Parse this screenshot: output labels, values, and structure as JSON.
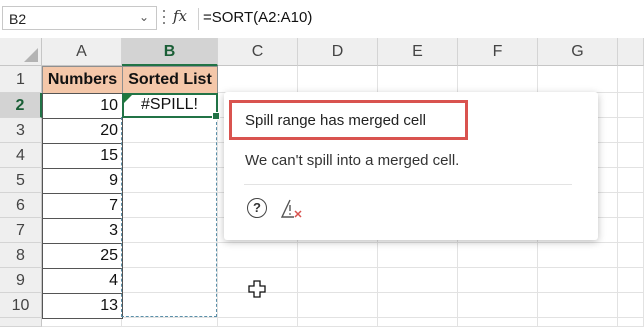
{
  "formula_bar": {
    "name_box": "B2",
    "name_box_dropdown_icon": "chevron-down-icon",
    "fx_label": "fx",
    "formula": "=SORT(A2:A10)"
  },
  "columns": [
    "A",
    "B",
    "C",
    "D",
    "E",
    "F",
    "G"
  ],
  "rows": [
    "1",
    "2",
    "3",
    "4",
    "5",
    "6",
    "7",
    "8",
    "9",
    "10"
  ],
  "sheet": {
    "a1": "Numbers",
    "b1": "Sorted List",
    "numbers": [
      "10",
      "20",
      "15",
      "9",
      "7",
      "3",
      "25",
      "4",
      "13"
    ],
    "b2": "#SPILL!"
  },
  "popup": {
    "title": "Spill range has merged cell",
    "message": "We can't spill into a merged cell.",
    "help_icon": "help-circle-icon",
    "warning_icon": "warning-icon"
  },
  "colors": {
    "header_fill": "#f4c7a9",
    "selection_green": "#217346",
    "highlight_red": "#d9534f"
  }
}
